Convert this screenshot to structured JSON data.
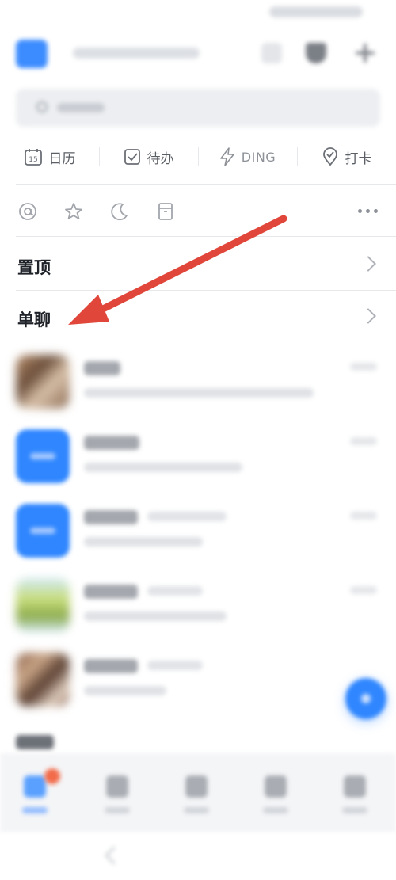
{
  "tools": [
    {
      "label": "日历",
      "icon": "calendar-icon",
      "day": "15"
    },
    {
      "label": "待办",
      "icon": "checkbox-icon"
    },
    {
      "label": "DING",
      "icon": "lightning-icon"
    },
    {
      "label": "打卡",
      "icon": "location-check-icon"
    }
  ],
  "filters": [
    "at-icon",
    "star-icon",
    "moon-icon",
    "archive-icon",
    "more-icon"
  ],
  "sections": {
    "pinned": "置顶",
    "single_chat": "单聊"
  },
  "colors": {
    "accent": "#2f86ff",
    "annotation_arrow": "#e0473a",
    "badge": "#f26b4a"
  }
}
